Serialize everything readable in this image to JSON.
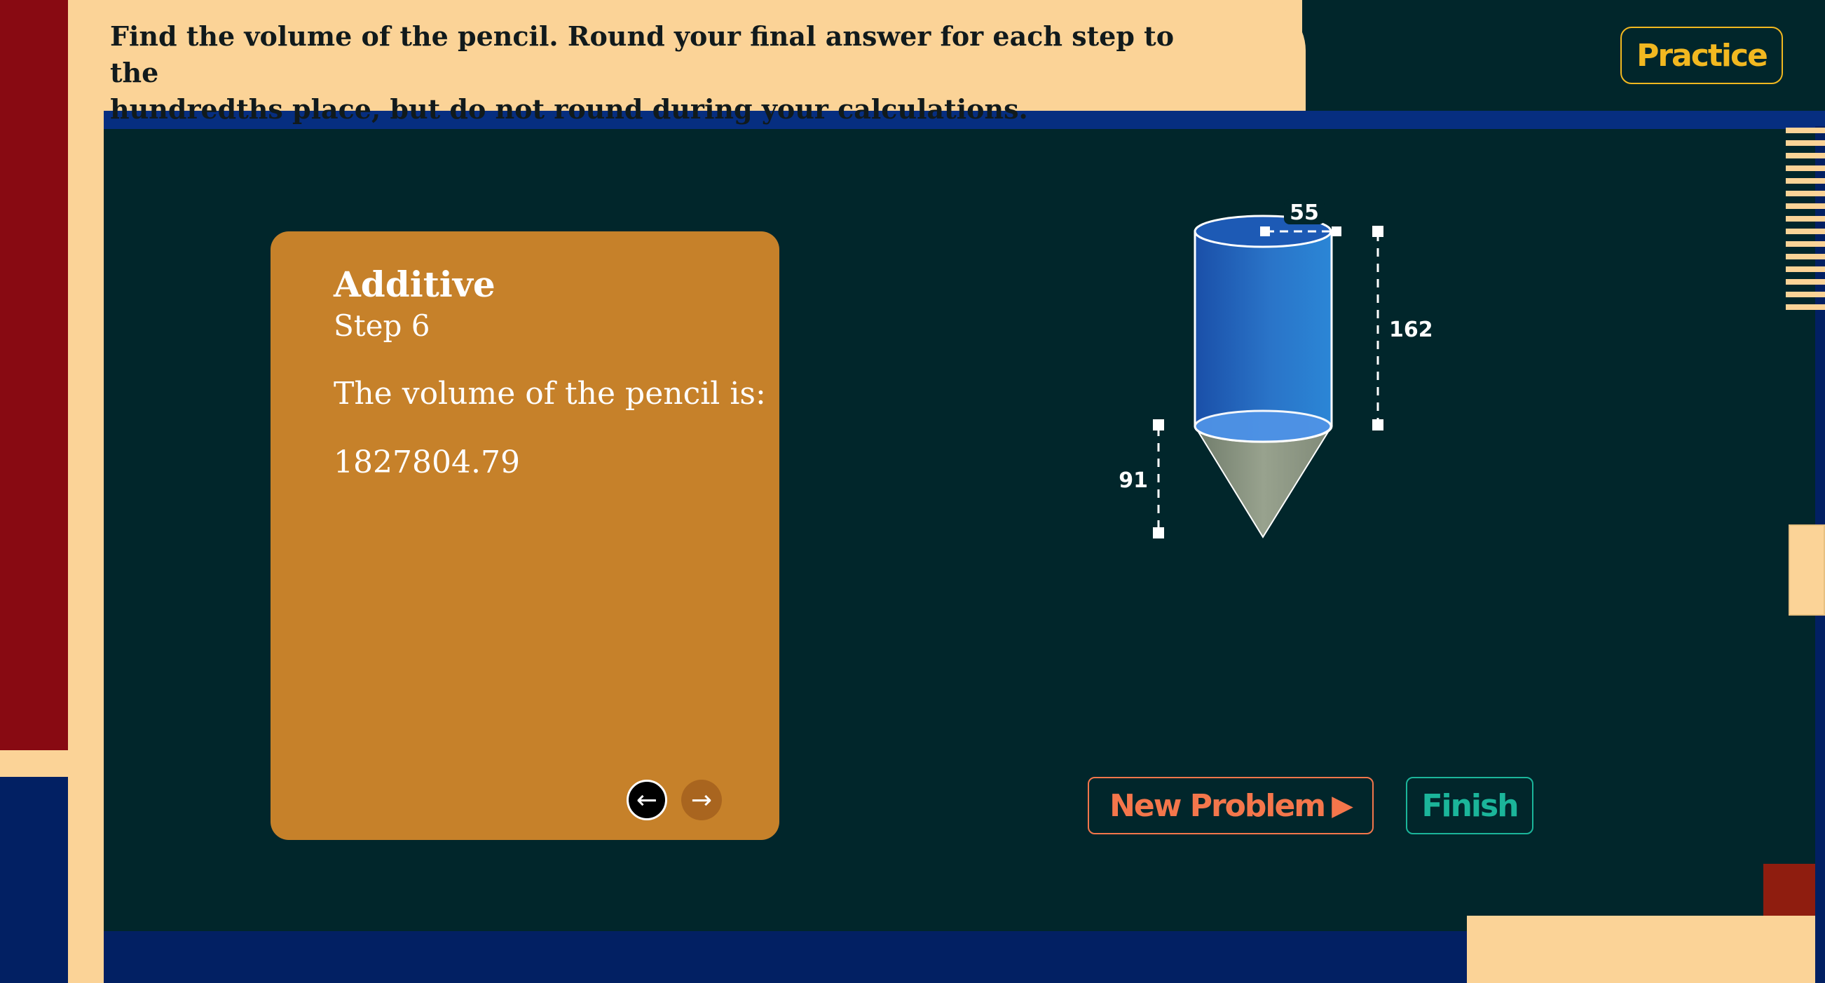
{
  "question": {
    "line1": "Find the volume of the pencil. Round your final answer for each step to the",
    "line2": "hundredths place, but do not round during your calculations."
  },
  "mode_badge": "Practice",
  "step_card": {
    "title": "Additive",
    "step": "Step 6",
    "text": "The volume of the pencil is:",
    "answer": "1827804.79",
    "prev_icon": "←",
    "next_icon": "→"
  },
  "figure": {
    "diameter": "55",
    "cylinder_height": "162",
    "cone_height": "91"
  },
  "buttons": {
    "new_problem": "New Problem",
    "new_problem_icon": "▶",
    "finish": "Finish"
  },
  "colors": {
    "board": "#01262b",
    "banner": "#fbd397",
    "card": "#c6812a",
    "practice": "#f2b820",
    "new_problem": "#f4764b",
    "finish": "#1bb59a"
  }
}
